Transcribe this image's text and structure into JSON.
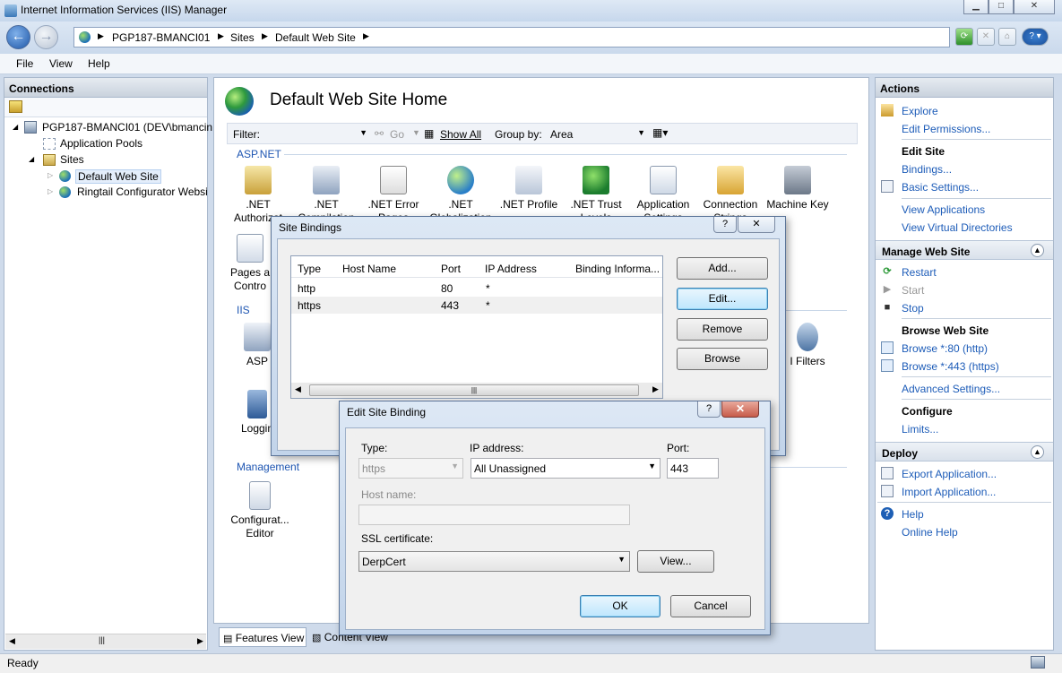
{
  "window": {
    "title": "Internet Information Services (IIS) Manager"
  },
  "address": {
    "crumbs": [
      "PGP187-BMANCI01",
      "Sites",
      "Default Web Site"
    ]
  },
  "menu": {
    "file": "File",
    "view": "View",
    "help": "Help"
  },
  "connections": {
    "header": "Connections",
    "tree": [
      {
        "label": "PGP187-BMANCI01 (DEV\\bmancin"
      },
      {
        "label": "Application Pools"
      },
      {
        "label": "Sites"
      },
      {
        "label": "Default Web Site"
      },
      {
        "label": "Ringtail Configurator Websi"
      }
    ]
  },
  "main": {
    "title": "Default Web Site Home",
    "filter_label": "Filter:",
    "go_label": "Go",
    "show_all_label": "Show All",
    "group_by_label": "Group by:",
    "group_by_value": "Area",
    "sections": {
      "aspnet": "ASP.NET",
      "iis": "IIS",
      "management": "Management"
    },
    "features_row1": [
      {
        "line1": ".NET",
        "line2": "Authorizat"
      },
      {
        "line1": ".NET",
        "line2": "Compilation"
      },
      {
        "line1": ".NET Error",
        "line2": "Pages"
      },
      {
        "line1": ".NET",
        "line2": "Globalization"
      },
      {
        "line1": ".NET Profile",
        "line2": ""
      },
      {
        "line1": ".NET Trust",
        "line2": "Levels"
      },
      {
        "line1": "Application",
        "line2": "Settings"
      },
      {
        "line1": "Connection",
        "line2": "Strings"
      },
      {
        "line1": "Machine Key",
        "line2": ""
      }
    ],
    "feature_pages": {
      "line1": "Pages a",
      "line2": "Contro"
    },
    "feature_asp": "ASP",
    "feature_logging": "Loggin",
    "feature_isapi": "I Filters",
    "feature_config_editor": {
      "line1": "Configurat...",
      "line2": "Editor"
    },
    "tabs": {
      "features_view": "Features View",
      "content_view": "Content View"
    }
  },
  "actions": {
    "header": "Actions",
    "explore": "Explore",
    "edit_permissions": "Edit Permissions...",
    "edit_site": "Edit Site",
    "bindings": "Bindings...",
    "basic_settings": "Basic Settings...",
    "view_applications": "View Applications",
    "view_virtual_directories": "View Virtual Directories",
    "manage_web_site": "Manage Web Site",
    "restart": "Restart",
    "start": "Start",
    "stop": "Stop",
    "browse_web_site": "Browse Web Site",
    "browse_80": "Browse *:80 (http)",
    "browse_443": "Browse *:443 (https)",
    "advanced_settings": "Advanced Settings...",
    "configure": "Configure",
    "limits": "Limits...",
    "deploy": "Deploy",
    "export_application": "Export Application...",
    "import_application": "Import Application...",
    "help": "Help",
    "online_help": "Online Help"
  },
  "site_bindings": {
    "title": "Site Bindings",
    "columns": [
      "Type",
      "Host Name",
      "Port",
      "IP Address",
      "Binding Informa..."
    ],
    "rows": [
      {
        "type": "http",
        "host": "",
        "port": "80",
        "ip": "*",
        "info": ""
      },
      {
        "type": "https",
        "host": "",
        "port": "443",
        "ip": "*",
        "info": ""
      }
    ],
    "buttons": {
      "add": "Add...",
      "edit": "Edit...",
      "remove": "Remove",
      "browse": "Browse"
    }
  },
  "edit_binding": {
    "title": "Edit Site Binding",
    "type_label": "Type:",
    "type_value": "https",
    "ip_label": "IP address:",
    "ip_value": "All Unassigned",
    "port_label": "Port:",
    "port_value": "443",
    "host_label": "Host name:",
    "host_value": "",
    "ssl_label": "SSL certificate:",
    "ssl_value": "DerpCert",
    "view_button": "View...",
    "ok_button": "OK",
    "cancel_button": "Cancel"
  },
  "status": {
    "text": "Ready"
  }
}
